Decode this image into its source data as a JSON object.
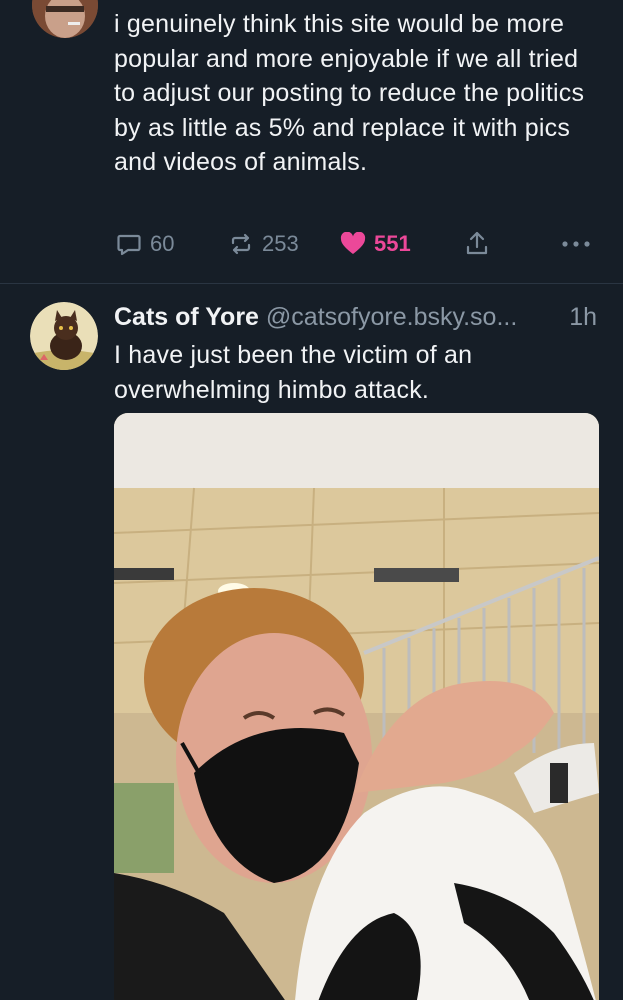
{
  "post1": {
    "text": "i genuinely think this site would be more popular and more enjoyable if we all tried to adjust our posting to reduce the politics by as little as 5% and replace it with pics and videos of animals.",
    "replies": "60",
    "reposts": "253",
    "likes": "551",
    "icons": [
      "reply-icon",
      "repost-icon",
      "heart-icon",
      "share-icon",
      "more-icon"
    ]
  },
  "post2": {
    "author_name": "Cats of Yore",
    "handle": "@catsofyore.bsky.so...",
    "time": "1h",
    "text": "I have just been the victim of an overwhelming himbo attack."
  },
  "colors": {
    "background": "#161e27",
    "text": "#f1f3f5",
    "muted": "#7b8a99",
    "like": "#ec4899",
    "divider": "#2a3542"
  }
}
